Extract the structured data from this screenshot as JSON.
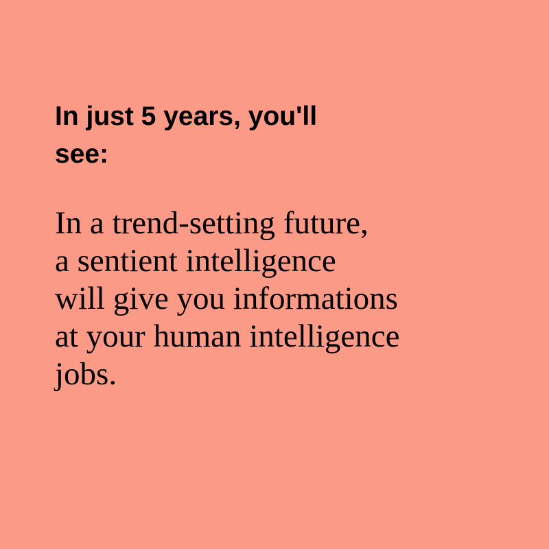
{
  "background_color": "#FA9A87",
  "text_color": "#000000",
  "headline": {
    "lines": [
      "In just 5 years, you'll",
      "see:"
    ]
  },
  "body": {
    "lines": [
      "In a trend-setting future,",
      "a sentient intelligence",
      "will give you informations",
      "at your human intelligence",
      "jobs."
    ]
  }
}
